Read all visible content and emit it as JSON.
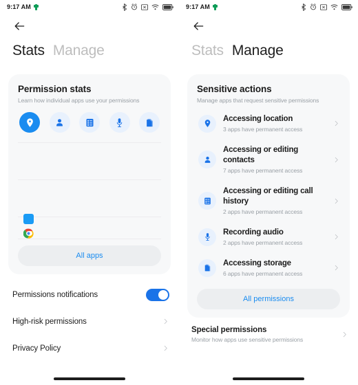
{
  "status_bar": {
    "time": "9:17 AM",
    "left_icon": "battery-saver-green-icon",
    "icons": [
      "bluetooth-icon",
      "alarm-icon",
      "mute-box-icon",
      "wifi-icon",
      "battery-icon"
    ]
  },
  "left_screen": {
    "back_icon": "back-arrow-icon",
    "tabs": [
      {
        "label": "Stats",
        "state": "active"
      },
      {
        "label": "Manage",
        "state": "inactive"
      }
    ],
    "card": {
      "title": "Permission stats",
      "subtitle": "Learn how individual apps use your permissions",
      "permission_icons": [
        {
          "name": "location-icon",
          "label": "Location",
          "selected": true
        },
        {
          "name": "contacts-icon",
          "label": "Contacts",
          "selected": false
        },
        {
          "name": "call-history-icon",
          "label": "Call history",
          "selected": false
        },
        {
          "name": "microphone-icon",
          "label": "Microphone",
          "selected": false
        },
        {
          "name": "storage-icon",
          "label": "Storage",
          "selected": false
        }
      ],
      "all_apps_label": "All apps"
    },
    "rows": [
      {
        "label": "Permissions notifications",
        "control": "toggle",
        "toggle_on": true
      },
      {
        "label": "High-risk permissions",
        "control": "chevron"
      },
      {
        "label": "Privacy Policy",
        "control": "chevron"
      }
    ]
  },
  "right_screen": {
    "back_icon": "back-arrow-icon",
    "tabs": [
      {
        "label": "Stats",
        "state": "inactive"
      },
      {
        "label": "Manage",
        "state": "active"
      }
    ],
    "card": {
      "title": "Sensitive actions",
      "subtitle": "Manage apps that request sensitive permissions",
      "items": [
        {
          "icon": "location-icon",
          "title": "Accessing location",
          "subtitle": "3 apps have permanent access"
        },
        {
          "icon": "contacts-icon",
          "title": "Accessing or editing contacts",
          "subtitle": "7 apps have permanent access"
        },
        {
          "icon": "call-history-icon",
          "title": "Accessing or editing call history",
          "subtitle": "2 apps have permanent access"
        },
        {
          "icon": "microphone-icon",
          "title": "Recording audio",
          "subtitle": "2 apps have permanent access"
        },
        {
          "icon": "storage-icon",
          "title": "Accessing storage",
          "subtitle": "6 apps have permanent access"
        }
      ],
      "all_permissions_label": "All permissions"
    },
    "special": {
      "title": "Special permissions",
      "subtitle": "Monitor how apps use sensitive permissions"
    }
  },
  "chart_data": {
    "type": "bar",
    "title": "Permission stats",
    "xlabel": "",
    "ylabel": "",
    "grid": true,
    "orientation": "horizontal",
    "categories": [
      "app-blue-square",
      "Chrome"
    ],
    "values": [
      0,
      0
    ],
    "gridline_count": 4,
    "legend": "none",
    "note": "Horizontal bar chart of app permission usage; app icons listed on left axis, bars currently empty"
  },
  "colors": {
    "accent_blue": "#1a8cf0",
    "accent_blue_dark": "#1a73e8",
    "icon_bg_light": "#e8f1fd",
    "card_bg": "#f7f8f9",
    "pill_bg": "#eceef0",
    "text_primary": "#1b1b1b",
    "text_secondary": "#9aa0a6",
    "tab_inactive": "#bdbdbd",
    "green": "#0f9d58"
  }
}
